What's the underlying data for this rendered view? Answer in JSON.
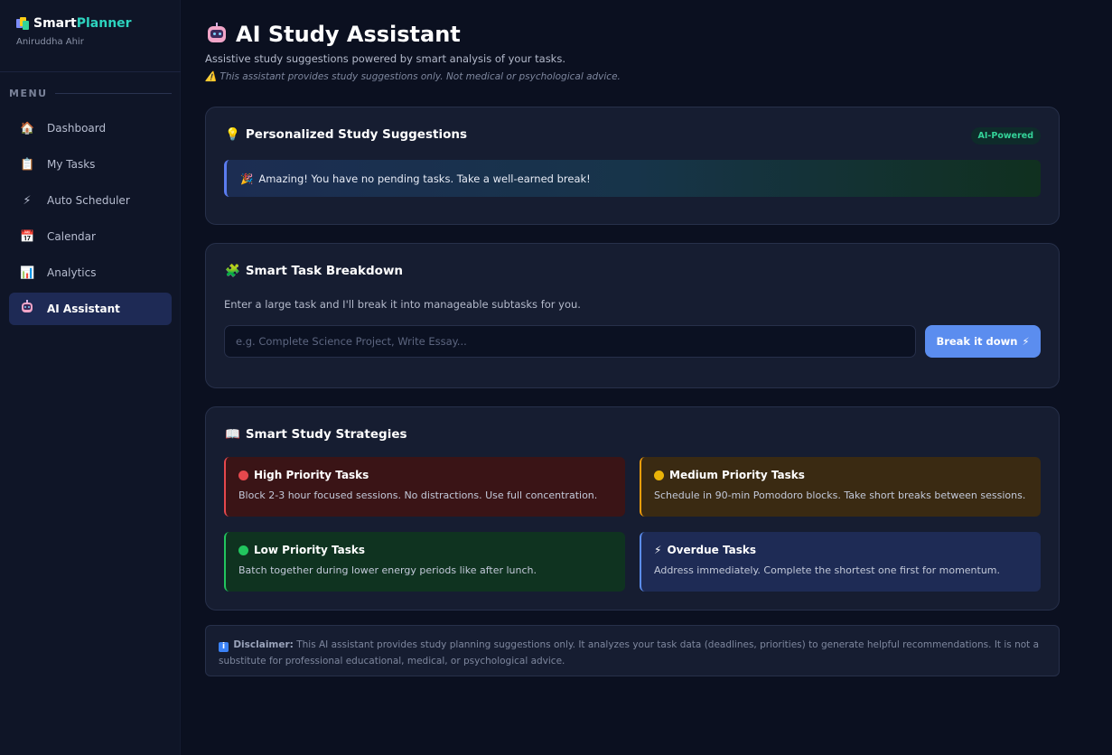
{
  "brand": {
    "name_part1": "Smart",
    "name_part2": "Planner",
    "user_name": "Aniruddha Ahir"
  },
  "sidebar": {
    "menu_heading": "MENU",
    "items": [
      {
        "label": "Dashboard",
        "icon": "house-icon",
        "glyph": "🏠"
      },
      {
        "label": "My Tasks",
        "icon": "clipboard-icon",
        "glyph": "📋"
      },
      {
        "label": "Auto Scheduler",
        "icon": "lightning-icon",
        "glyph": "⚡"
      },
      {
        "label": "Calendar",
        "icon": "calendar-icon",
        "glyph": "📅"
      },
      {
        "label": "Analytics",
        "icon": "chart-icon",
        "glyph": "📊"
      },
      {
        "label": "AI Assistant",
        "icon": "robot-icon",
        "glyph": "",
        "active": true
      }
    ]
  },
  "header": {
    "title": "AI Study Assistant",
    "subtitle": "Assistive study suggestions powered by smart analysis of your tasks.",
    "warning": "This assistant provides study suggestions only. Not medical or psychological advice."
  },
  "suggestions": {
    "title": "Personalized Study Suggestions",
    "badge": "AI-Powered",
    "message": "Amazing! You have no pending tasks. Take a well-earned break!"
  },
  "breakdown": {
    "title": "Smart Task Breakdown",
    "description": "Enter a large task and I'll break it into manageable subtasks for you.",
    "input_value": "",
    "input_placeholder": "e.g. Complete Science Project, Write Essay...",
    "button_label": "Break it down"
  },
  "strategies": {
    "title": "Smart Study Strategies",
    "items": [
      {
        "title": "High Priority Tasks",
        "text": "Block 2-3 hour focused sessions. No distractions. Use full concentration.",
        "color": "#e5484d"
      },
      {
        "title": "Medium Priority Tasks",
        "text": "Schedule in 90-min Pomodoro blocks. Take short breaks between sessions.",
        "color": "#f59e0b"
      },
      {
        "title": "Low Priority Tasks",
        "text": "Batch together during lower energy periods like after lunch.",
        "color": "#22c55e"
      },
      {
        "title": "Overdue Tasks",
        "text": "Address immediately. Complete the shortest one first for momentum.",
        "color": "#5b8def"
      }
    ]
  },
  "disclaimer": {
    "label": "Disclaimer:",
    "text": "This AI assistant provides study planning suggestions only. It analyzes your task data (deadlines, priorities) to generate helpful recommendations. It is not a substitute for professional educational, medical, or psychological advice."
  },
  "colors": {
    "accent": "#5b8def",
    "brand_teal": "#2dd4bf",
    "background": "#0b1020",
    "card": "#161d31",
    "badge_green": "#34d399"
  }
}
